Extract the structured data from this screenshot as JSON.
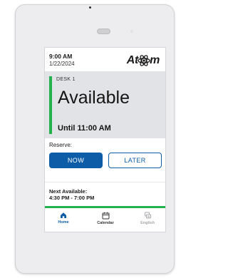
{
  "header": {
    "time": "9:00 AM",
    "date": "1/22/2024",
    "logo_text_left": "At",
    "logo_text_right": "m",
    "logo_icon": "atom-icon"
  },
  "status": {
    "desk": "DESK 1",
    "state": "Available",
    "until": "Until 11:00 AM",
    "color": "#22b14c"
  },
  "reserve": {
    "label": "Reserve:",
    "now_label": "NOW",
    "later_label": "LATER",
    "accent": "#0d5ca8"
  },
  "next": {
    "label": "Next Available:",
    "range": "4:30 PM - 7:00 PM"
  },
  "nav": {
    "items": [
      {
        "label": "Home",
        "icon": "home-icon",
        "active": true
      },
      {
        "label": "Calendar",
        "icon": "calendar-icon",
        "active": false
      },
      {
        "label": "English",
        "icon": "language-icon",
        "active": false
      }
    ]
  }
}
